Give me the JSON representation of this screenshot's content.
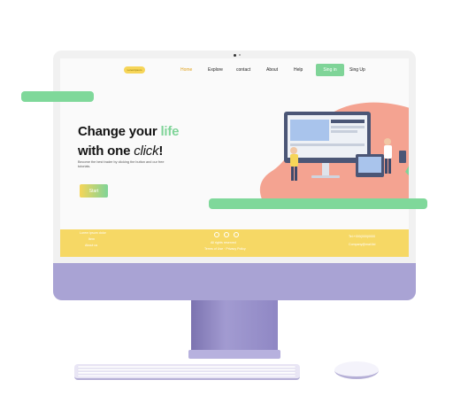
{
  "nav": {
    "logo": "LoremIpsum",
    "links": [
      "Home",
      "Explore",
      "contact",
      "About",
      "Help"
    ],
    "signin": "Sing in",
    "signup": "Sing Up"
  },
  "hero": {
    "line1_a": "Change your ",
    "line1_b": "life",
    "line2_a": "with one ",
    "line2_b": "click",
    "line2_c": "!",
    "subtitle": "Become the best trader by clicking the button and our free tutorials.",
    "button": "Start"
  },
  "footer": {
    "left": [
      "Lorem ipsum dolor",
      "Item",
      "About us"
    ],
    "center": [
      "All rights reserved",
      "Terms of Use · Privacy Policy"
    ],
    "right": [
      "Tel:+000(000)0000",
      "Company@mail.ltd"
    ]
  },
  "colors": {
    "accent_green": "#7fd498",
    "accent_yellow": "#f6d865",
    "salmon": "#f4a391",
    "device_purple": "#a9a3d4"
  },
  "icons": [
    "camera-icon",
    "facebook-icon",
    "instagram-icon",
    "twitter-icon",
    "keyboard",
    "mouse"
  ]
}
